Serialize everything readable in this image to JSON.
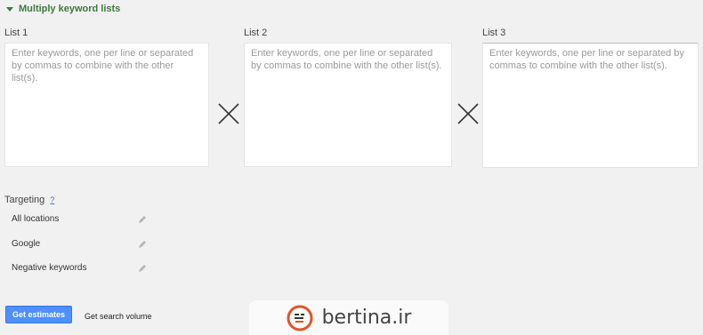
{
  "section": {
    "title": "Multiply keyword lists",
    "caret_icon": "triangle-down-icon"
  },
  "lists": [
    {
      "label": "List 1",
      "placeholder": "Enter keywords, one per line or separated by commas to combine with the other list(s)."
    },
    {
      "label": "List 2",
      "placeholder": "Enter keywords, one per line or separated by commas to combine with the other list(s)."
    },
    {
      "label": "List 3",
      "placeholder": "Enter keywords, one per line or separated by commas to combine with the other list(s)."
    }
  ],
  "operator_icon": "multiply-icon",
  "targeting": {
    "label": "Targeting",
    "help": "?",
    "items": [
      {
        "label": "All locations",
        "icon": "pencil-icon"
      },
      {
        "label": "Google",
        "icon": "pencil-icon"
      },
      {
        "label": "Negative keywords",
        "icon": "pencil-icon"
      }
    ]
  },
  "actions": {
    "primary": "Get estimates",
    "secondary": "Get search volume"
  },
  "watermark": {
    "text": "bertina.ir",
    "icon": "bertina-logo-icon"
  },
  "colors": {
    "accent_green": "#3d7a3d",
    "button_blue": "#4d90fe",
    "link_blue": "#4a73b8",
    "background": "#f1f1f1"
  }
}
